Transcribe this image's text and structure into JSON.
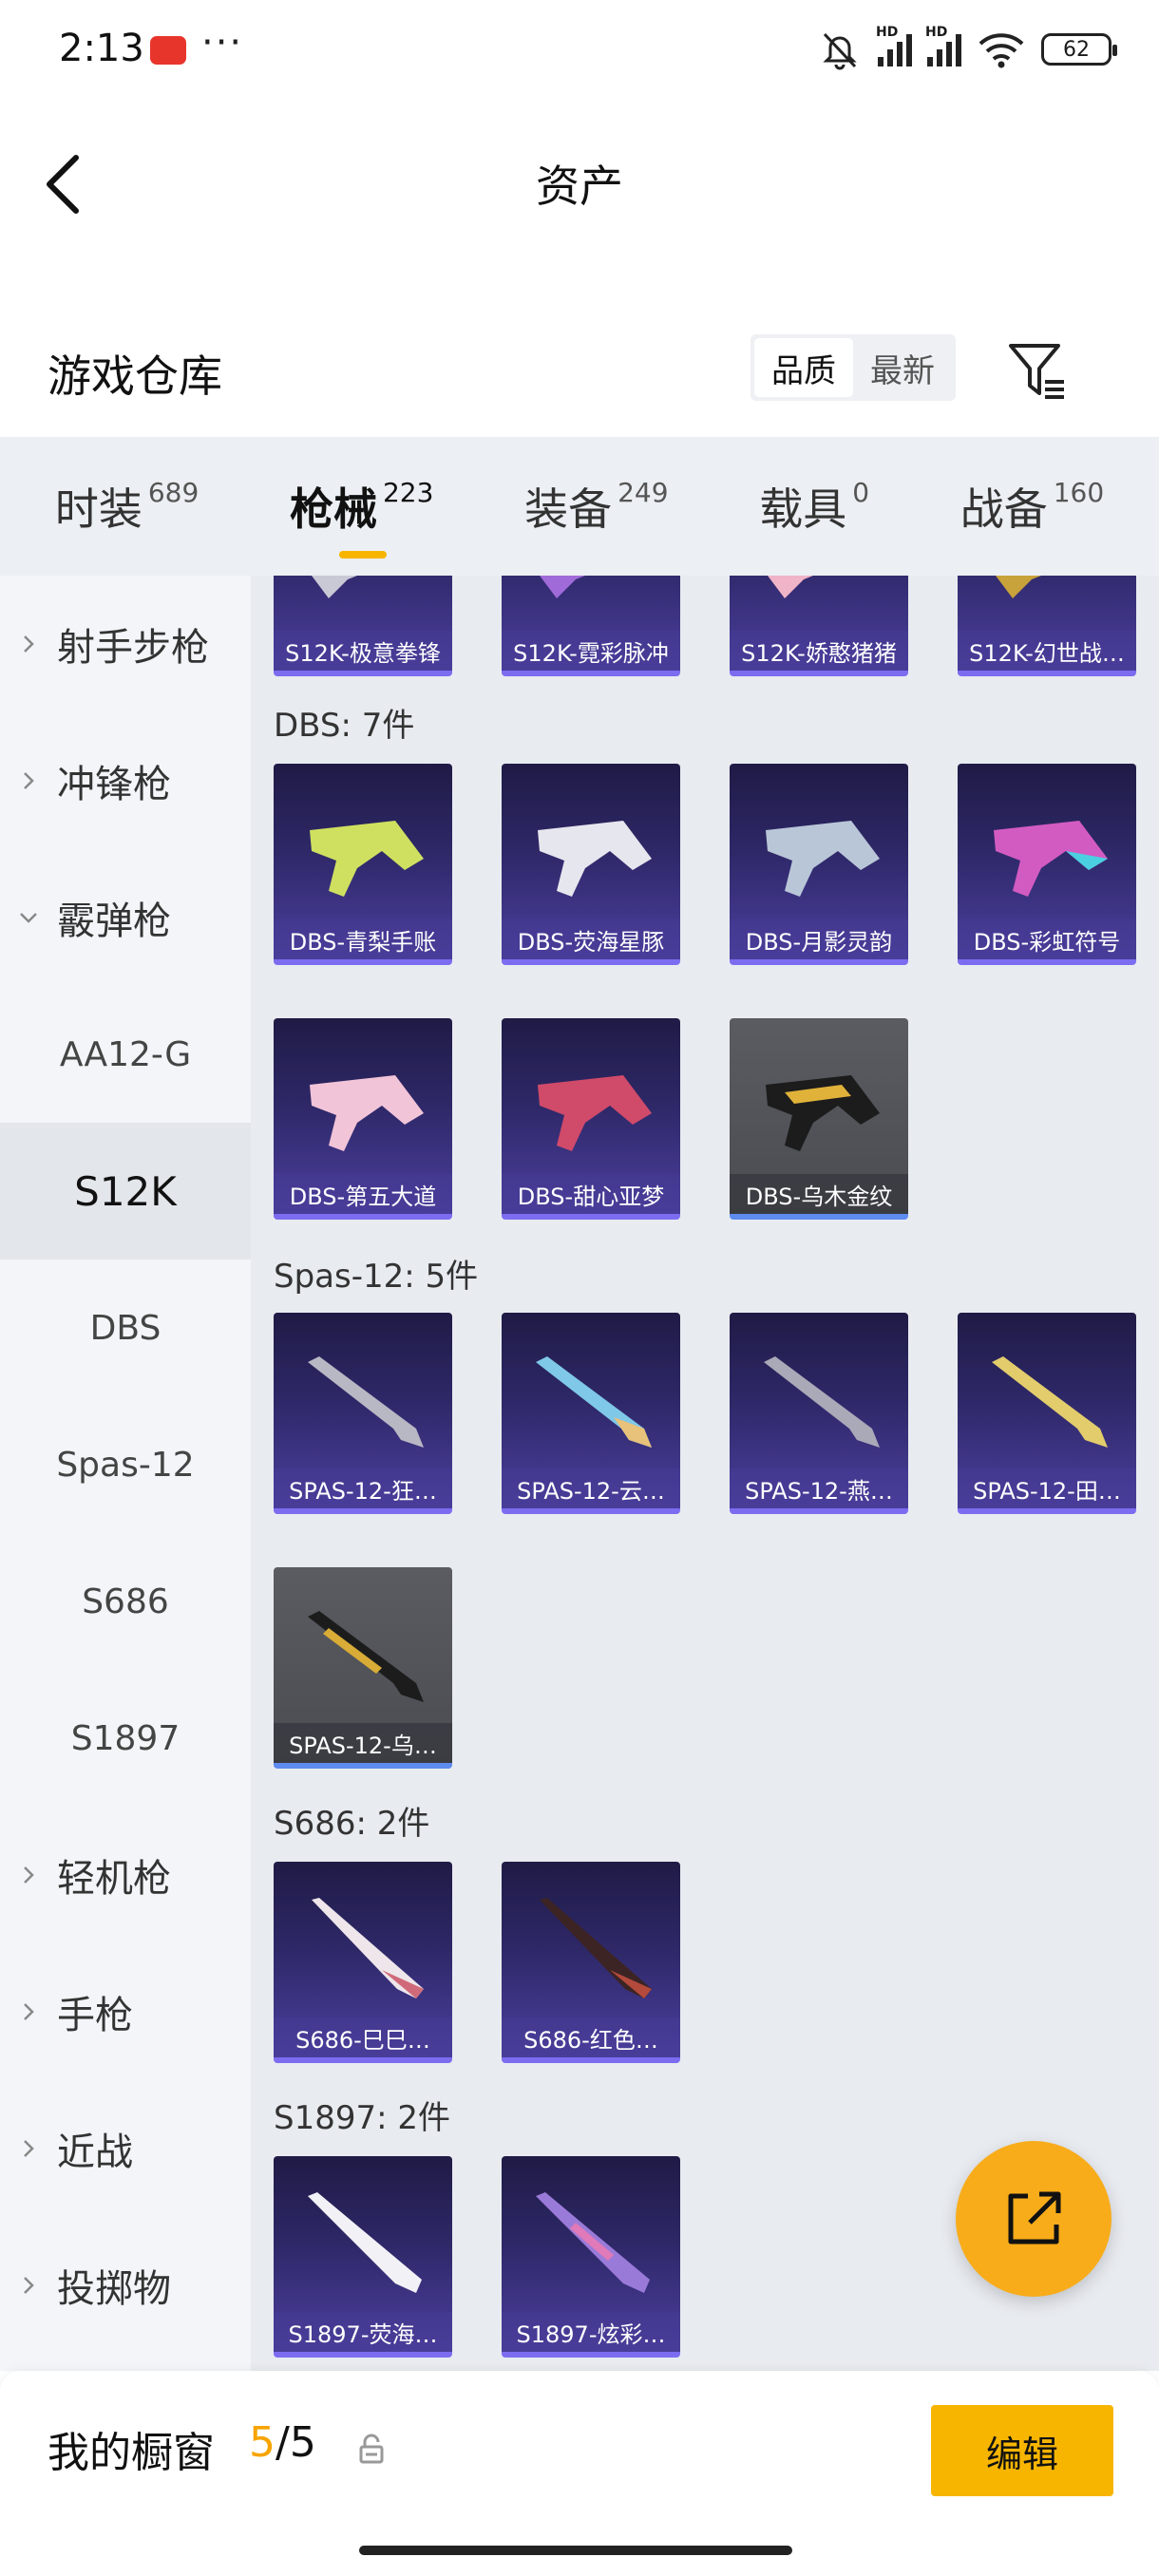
{
  "status": {
    "time": "2:13",
    "dots": "···",
    "battery": "62",
    "hd": "HD"
  },
  "header": {
    "title": "资产"
  },
  "warehouse": {
    "title": "游戏仓库",
    "sort_quality": "品质",
    "sort_latest": "最新"
  },
  "tabs": [
    {
      "label": "时装",
      "count": "689"
    },
    {
      "label": "枪械",
      "count": "223"
    },
    {
      "label": "装备",
      "count": "249"
    },
    {
      "label": "载具",
      "count": "0"
    },
    {
      "label": "战备",
      "count": "160"
    }
  ],
  "sidebar": {
    "cat_marksman": "射手步枪",
    "cat_smg": "冲锋枪",
    "cat_shotgun": "霰弹枪",
    "sub_aa12": "AA12-G",
    "sub_s12k": "S12K",
    "sub_dbs": "DBS",
    "sub_spas": "Spas-12",
    "sub_s686": "S686",
    "sub_s1897": "S1897",
    "cat_lmg": "轻机枪",
    "cat_pistol": "手枪",
    "cat_melee": "近战",
    "cat_throw": "投掷物"
  },
  "groups": {
    "s12k": [
      "S12K-极意拳锋",
      "S12K-霓彩脉冲",
      "S12K-娇憨猪猪",
      "S12K-幻世战…"
    ],
    "dbs_label": "DBS: 7件",
    "dbs": [
      "DBS-青梨手账",
      "DBS-荧海星豚",
      "DBS-月影灵韵",
      "DBS-彩虹符号",
      "DBS-第五大道",
      "DBS-甜心亚梦",
      "DBS-乌木金纹"
    ],
    "spas_label": "Spas-12: 5件",
    "spas": [
      "SPAS-12-狂…",
      "SPAS-12-云…",
      "SPAS-12-燕…",
      "SPAS-12-田…",
      "SPAS-12-乌…"
    ],
    "s686_label": "S686: 2件",
    "s686": [
      "S686-巳巳…",
      "S686-红色…"
    ],
    "s1897_label": "S1897: 2件",
    "s1897": [
      "S1897-荧海…",
      "S1897-炫彩…"
    ]
  },
  "bottom": {
    "showcase_label": "我的橱窗",
    "current": "5",
    "separator": "/",
    "total": "5",
    "edit": "编辑"
  },
  "colors": {
    "accent": "#f7b500",
    "card_purple": "#2e2868",
    "card_gray": "#4a4c52"
  }
}
